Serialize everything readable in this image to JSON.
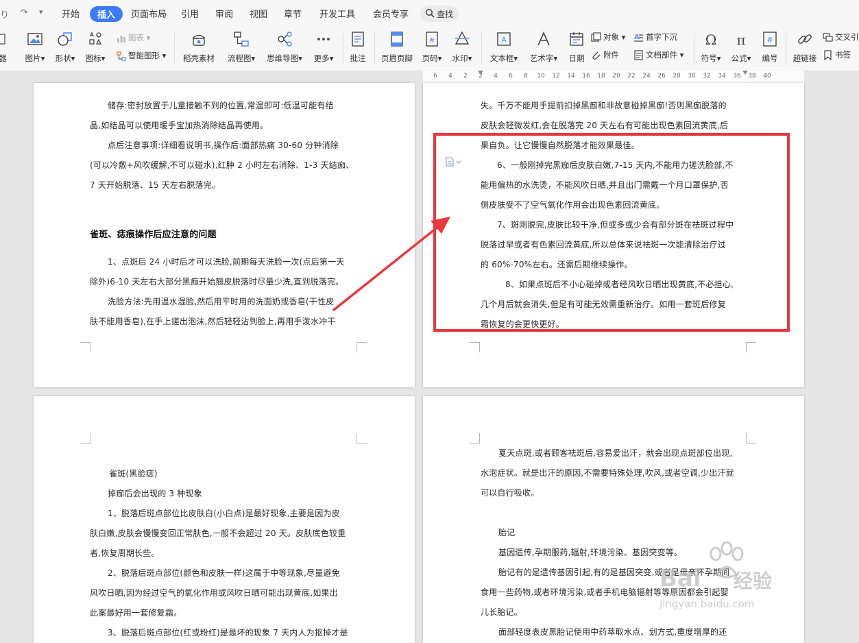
{
  "quick_access": {
    "undo_glyph": "り",
    "redo_glyph": "↷",
    "more_glyph": "▾"
  },
  "tabs": [
    {
      "label": "开始",
      "active": false
    },
    {
      "label": "插入",
      "active": true
    },
    {
      "label": "页面布局",
      "active": false
    },
    {
      "label": "引用",
      "active": false
    },
    {
      "label": "审阅",
      "active": false
    },
    {
      "label": "视图",
      "active": false
    },
    {
      "label": "章节",
      "active": false
    },
    {
      "label": "开发工具",
      "active": false
    },
    {
      "label": "会员专享",
      "active": false
    }
  ],
  "search": {
    "label": "查找"
  },
  "ribbon": {
    "partial_left_label": "器",
    "picture": "图片",
    "shape": "形状",
    "icon": "图标",
    "chart": "图表",
    "smart_art": "智能图形",
    "material": "稻壳素材",
    "flowchart": "流程图",
    "mindmap": "思维导图",
    "more": "更多",
    "comment": "批注",
    "header_footer": "页眉页脚",
    "page_number": "页码",
    "watermark": "水印",
    "textbox": "文本框",
    "wordart": "艺术字",
    "date": "日期",
    "object": "对象",
    "attachment": "附件",
    "drop_cap": "首字下沉",
    "doc_parts": "文档部件",
    "symbol": "符号",
    "formula": "公式",
    "numbering": "编号",
    "hyperlink": "超链接",
    "cross_ref": "交叉引",
    "bookmark": "书签"
  },
  "ruler": {
    "ticks": [
      "6",
      "4",
      "2",
      "2",
      "4",
      "6",
      "8",
      "10",
      "12",
      "14",
      "16",
      "18",
      "20",
      "22",
      "24",
      "26",
      "28",
      "30",
      "32",
      "34",
      "36",
      "38",
      "40"
    ]
  },
  "pages": {
    "top_left": {
      "lines": [
        "储存:密封放置于儿童接触不到的位置,常温即可:低温可能有结",
        "晶,如结晶可以使用暖手宝加热消除结晶再使用。",
        "点后注意事项:详细看说明书,操作后:面部热痛 30-60 分钟消除",
        "(可以冷敷+风吹缓解,不可以碰水),红肿 2 小时左右消除、1-3 天结痂、",
        "7 天开始脱落、15 天左右脱落完。",
        "雀斑、痣痕操作后应注意的问题",
        "1、点斑后 24 小时后才可以洗脸,前期每天洗脸一次(点后第一天",
        "除外)6-10 天左右大部分黑痂开始翘皮脱落时尽量少洗,直到脱落完。",
        "洗脸方法:先用温水湿脸,然后用平时用的洗面奶或香皂(干性皮",
        "肤不能用香皂),在手上搓出泡沫,然后轻轻沾到脸上,再用手泼水冲干"
      ]
    },
    "top_right": {
      "lines": [
        "失。千万不能用手提前扣掉黑痂和非故意碰掉黑痂!否则黑痂脱落的",
        "皮肤会轻微发红,会在脱落完 20 天左右有可能出现色素回流黄底,后",
        "果自负。让它慢慢自然脱落才能效果最佳。",
        "6、一般刚掉完黑痂后皮肤白嫩,7-15 天内,不能用力搓洗脸部,不",
        "能用偏热的水洗烫，不能风吹日晒,并且出门需戴一个月口罩保护,否",
        "侧皮肤受不了空气氧化作用会出现色素回流黄底。",
        "7、斑刚脱完,皮肤比较干净,但或多或少会有部分斑在祛斑过程中",
        "脱落过早或者有色素回流黄底,所以总体来说祛斑一次能清除治疗过",
        "的 60%-70%左右。还需后期继续操作。",
        "8、如果点斑后不小心碰掉或者经风吹日晒出现黄底,不必担心,",
        "几个月后就会消失,但是有可能无效需重新治疗。如用一套斑后修复",
        "霜恢复的会更快更好。"
      ]
    },
    "bottom_left": {
      "lines": [
        "雀斑(黑脸痣)",
        "掉痂后会出现的 3 种现象",
        "1、脱落后斑点部位比皮肤白(小白点)是最好现象,主要是因为皮",
        "肤白嫩,皮肤会慢慢变回正常肤色,一般不会超过 20 天。皮肤底色较重",
        "者,恢复周期长些。",
        "2、脱落后斑点部位(颜色和皮肤一样)这属于中等现象,尽量避免",
        "风吹日晒,因为经过空气的氧化作用或风吹日晒可能出现黄底,如果出",
        "此案最好用一套修复霜。",
        "3、脱落后斑点部位(红或粉红)是最坏的现象 7 天内人为抠掉才是"
      ]
    },
    "bottom_right": {
      "lines": [
        "夏天点斑,或者顾客祛斑后,容易爱出汗，就会出现点斑部位出现,",
        "水泡症状。就是出汗的原因,不需要特殊处理,吹风,或者空调,少出汗就",
        "可以自行吸收。",
        "胎记",
        "基因遗传,孕期服药,辐射,环境污染、基因突变等。",
        "胎记有的是遗传基因引起,有的是基因突变,或者是母亲怀孕期间",
        "食用一些药物,或者环境污染,或者手机电脑辐射等等原因都会引起婴",
        "儿长胎记。",
        "面部轻度表皮黑胎记使用中药萃取水点、划方式,重度增厚的还"
      ]
    }
  },
  "watermark": {
    "brand": "Bai",
    "brand_cn": "经验",
    "url": "jingyan.baidu.com"
  },
  "colors": {
    "accent": "#3b7cf4",
    "highlight": "#e8383d"
  }
}
